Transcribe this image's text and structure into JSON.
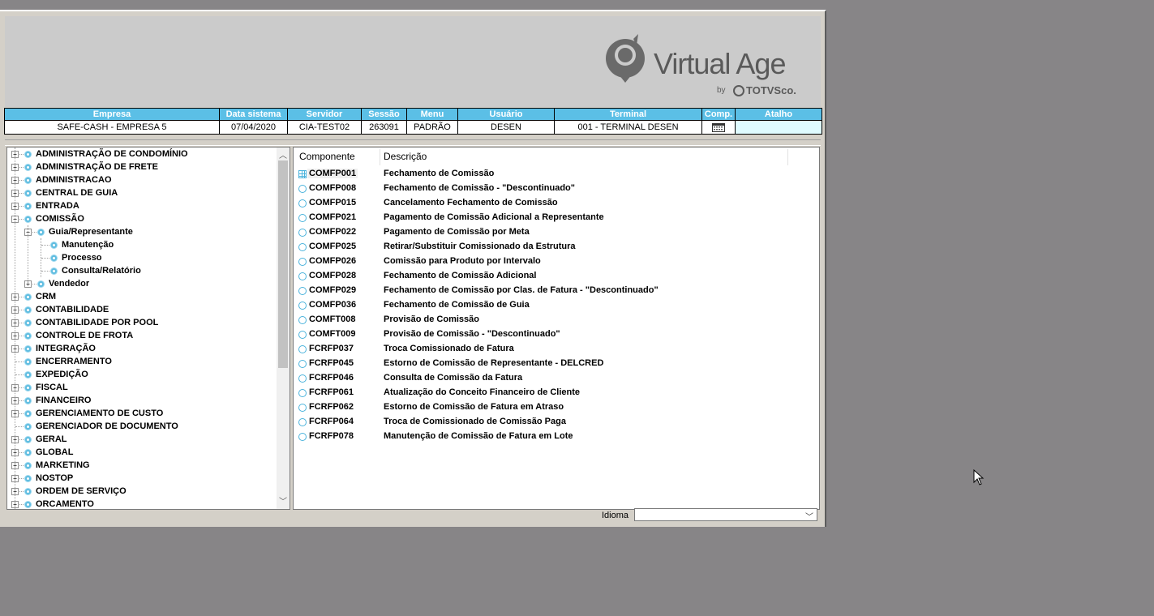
{
  "brand": {
    "name": "Virtual Age",
    "by": "by",
    "totvs": "TOTVSco."
  },
  "info_bar": {
    "headers": [
      "Empresa",
      "Data sistema",
      "Servidor",
      "Sessão",
      "Menu",
      "Usuário",
      "Terminal",
      "Comp.",
      "Atalho"
    ],
    "values": [
      "SAFE-CASH - EMPRESA 5",
      "07/04/2020",
      "CIA-TEST02",
      "263091",
      "PADRÃO",
      "DESEN",
      "001 - TERMINAL DESEN",
      "",
      ""
    ]
  },
  "tree": {
    "items": [
      {
        "label": "ADMINISTRAÇÃO DE CONDOMÍNIO",
        "level": 0,
        "expander": "+"
      },
      {
        "label": "ADMINISTRAÇÃO DE FRETE",
        "level": 0,
        "expander": "+"
      },
      {
        "label": "ADMINISTRACAO",
        "level": 0,
        "expander": "+"
      },
      {
        "label": "CENTRAL DE GUIA",
        "level": 0,
        "expander": "+"
      },
      {
        "label": "ENTRADA",
        "level": 0,
        "expander": "+"
      },
      {
        "label": "COMISSÃO",
        "level": 0,
        "expander": "-"
      },
      {
        "label": "Guia/Representante",
        "level": 1,
        "expander": "-"
      },
      {
        "label": "Manutenção",
        "level": 2,
        "expander": ""
      },
      {
        "label": "Processo",
        "level": 2,
        "expander": ""
      },
      {
        "label": "Consulta/Relatório",
        "level": 2,
        "expander": ""
      },
      {
        "label": "Vendedor",
        "level": 1,
        "expander": "+"
      },
      {
        "label": "CRM",
        "level": 0,
        "expander": "+"
      },
      {
        "label": "CONTABILIDADE",
        "level": 0,
        "expander": "+"
      },
      {
        "label": "CONTABILIDADE POR POOL",
        "level": 0,
        "expander": "+"
      },
      {
        "label": "CONTROLE DE FROTA",
        "level": 0,
        "expander": "+"
      },
      {
        "label": "INTEGRAÇÃO",
        "level": 0,
        "expander": "+"
      },
      {
        "label": "ENCERRAMENTO",
        "level": 0,
        "expander": ""
      },
      {
        "label": "EXPEDIÇÃO",
        "level": 0,
        "expander": ""
      },
      {
        "label": "FISCAL",
        "level": 0,
        "expander": "+"
      },
      {
        "label": "FINANCEIRO",
        "level": 0,
        "expander": "+"
      },
      {
        "label": "GERENCIAMENTO DE CUSTO",
        "level": 0,
        "expander": "+"
      },
      {
        "label": "GERENCIADOR DE DOCUMENTO",
        "level": 0,
        "expander": ""
      },
      {
        "label": "GERAL",
        "level": 0,
        "expander": "+"
      },
      {
        "label": "GLOBAL",
        "level": 0,
        "expander": "+"
      },
      {
        "label": "MARKETING",
        "level": 0,
        "expander": "+"
      },
      {
        "label": "NOSTOP",
        "level": 0,
        "expander": "+"
      },
      {
        "label": "ORDEM DE SERVIÇO",
        "level": 0,
        "expander": "+"
      },
      {
        "label": "ORCAMENTO",
        "level": 0,
        "expander": "+"
      }
    ]
  },
  "list": {
    "headers": {
      "componente": "Componente",
      "descricao": "Descrição"
    },
    "rows": [
      {
        "code": "COMFP001",
        "desc": "Fechamento de Comissão",
        "icon": "grid-icon"
      },
      {
        "code": "COMFP008",
        "desc": "Fechamento de Comissão - \"Descontinuado\"",
        "icon": "ring-icon"
      },
      {
        "code": "COMFP015",
        "desc": "Cancelamento Fechamento de Comissão",
        "icon": "ring-icon"
      },
      {
        "code": "COMFP021",
        "desc": "Pagamento de Comissão Adicional a Representante",
        "icon": "ring-icon"
      },
      {
        "code": "COMFP022",
        "desc": "Pagamento de Comissão por Meta",
        "icon": "ring-icon"
      },
      {
        "code": "COMFP025",
        "desc": "Retirar/Substituir Comissionado da Estrutura",
        "icon": "ring-icon"
      },
      {
        "code": "COMFP026",
        "desc": "Comissão para Produto por Intervalo",
        "icon": "ring-icon"
      },
      {
        "code": "COMFP028",
        "desc": "Fechamento de Comissão Adicional",
        "icon": "ring-icon"
      },
      {
        "code": "COMFP029",
        "desc": "Fechamento de Comissão por Clas. de Fatura - \"Descontinuado\"",
        "icon": "ring-icon"
      },
      {
        "code": "COMFP036",
        "desc": "Fechamento de Comissão de Guia",
        "icon": "ring-icon"
      },
      {
        "code": "COMFT008",
        "desc": "Provisão de Comissão",
        "icon": "ring-icon"
      },
      {
        "code": "COMFT009",
        "desc": "Provisão de Comissão - \"Descontinuado\"",
        "icon": "ring-icon"
      },
      {
        "code": "FCRFP037",
        "desc": "Troca Comissionado de Fatura",
        "icon": "ring-icon"
      },
      {
        "code": "FCRFP045",
        "desc": "Estorno de Comissão de Representante - DELCRED",
        "icon": "ring-icon"
      },
      {
        "code": "FCRFP046",
        "desc": "Consulta de Comissão da Fatura",
        "icon": "ring-icon"
      },
      {
        "code": "FCRFP061",
        "desc": "Atualização do Conceito Financeiro de Cliente",
        "icon": "ring-icon"
      },
      {
        "code": "FCRFP062",
        "desc": "Estorno de Comissão de Fatura em Atraso",
        "icon": "ring-icon"
      },
      {
        "code": "FCRFP064",
        "desc": "Troca de Comissionado de Comissão Paga",
        "icon": "ring-icon"
      },
      {
        "code": "FCRFP078",
        "desc": "Manutenção de Comissão de Fatura em Lote",
        "icon": "ring-icon"
      }
    ]
  },
  "footer": {
    "idioma_label": "Idioma",
    "idioma_value": ""
  },
  "colors": {
    "header_blue": "#5bbfe6",
    "atalho_bg": "#dffbff",
    "desktop": "#878587"
  }
}
